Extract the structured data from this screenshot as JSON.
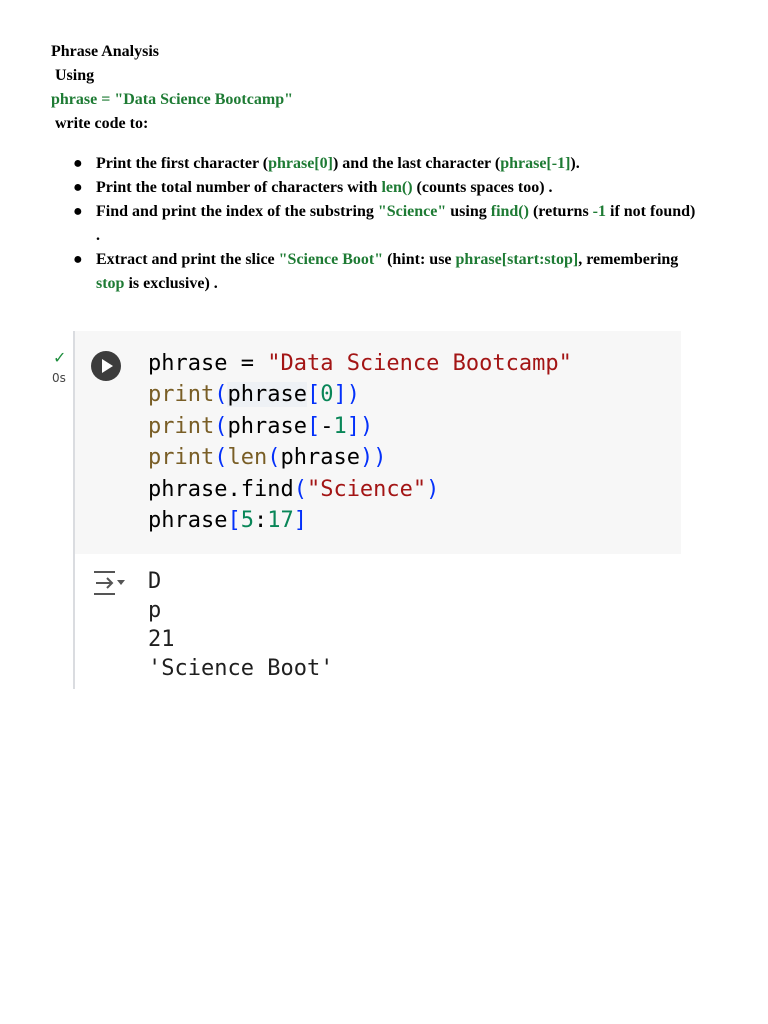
{
  "doc": {
    "title": "Phrase Analysis",
    "using": "Using",
    "phrase_line": "phrase = \"Data Science Bootcamp\"",
    "write_code": "write code to:",
    "tasks": [
      {
        "p1": "Print the first character (",
        "c1": "phrase[0]",
        "p2": ") and the last character (",
        "c2": "phrase[-1]",
        "p3": ")."
      },
      {
        "p1": "Print the total number of characters with ",
        "c1": "len()",
        "p2": " (counts spaces too) ."
      },
      {
        "p1": "Find and print the index of the substring ",
        "c1": "\"Science\"",
        "p2": " using ",
        "c2": "find()",
        "p3": " (returns ",
        "c3": "-1",
        "p4": " if not found) ."
      },
      {
        "p1": "Extract and print the slice ",
        "c1": "\"Science Boot\"",
        "p2": " (hint: use ",
        "c2": "phrase[start:stop]",
        "p3": ", remembering ",
        "c3": "stop",
        "p4": " is exclusive) ."
      }
    ]
  },
  "cell": {
    "status_check": "✓",
    "status_time": "0s",
    "code_lines": [
      "phrase = \"Data Science Bootcamp\"",
      "print(phrase[0])",
      "print(phrase[-1])",
      "print(len(phrase))",
      "phrase.find(\"Science\")",
      "phrase[5:17]"
    ],
    "output_lines": [
      "D",
      "p",
      "21",
      "'Science Boot'"
    ]
  },
  "colors": {
    "green_text": "#1e7b34",
    "string": "#a31515",
    "function": "#795e26",
    "bracket": "#0431fa",
    "number": "#098658",
    "cell_bg": "#f7f7f7"
  },
  "icons": {
    "run": "play-circle-icon",
    "output": "output-toggle-icon"
  }
}
